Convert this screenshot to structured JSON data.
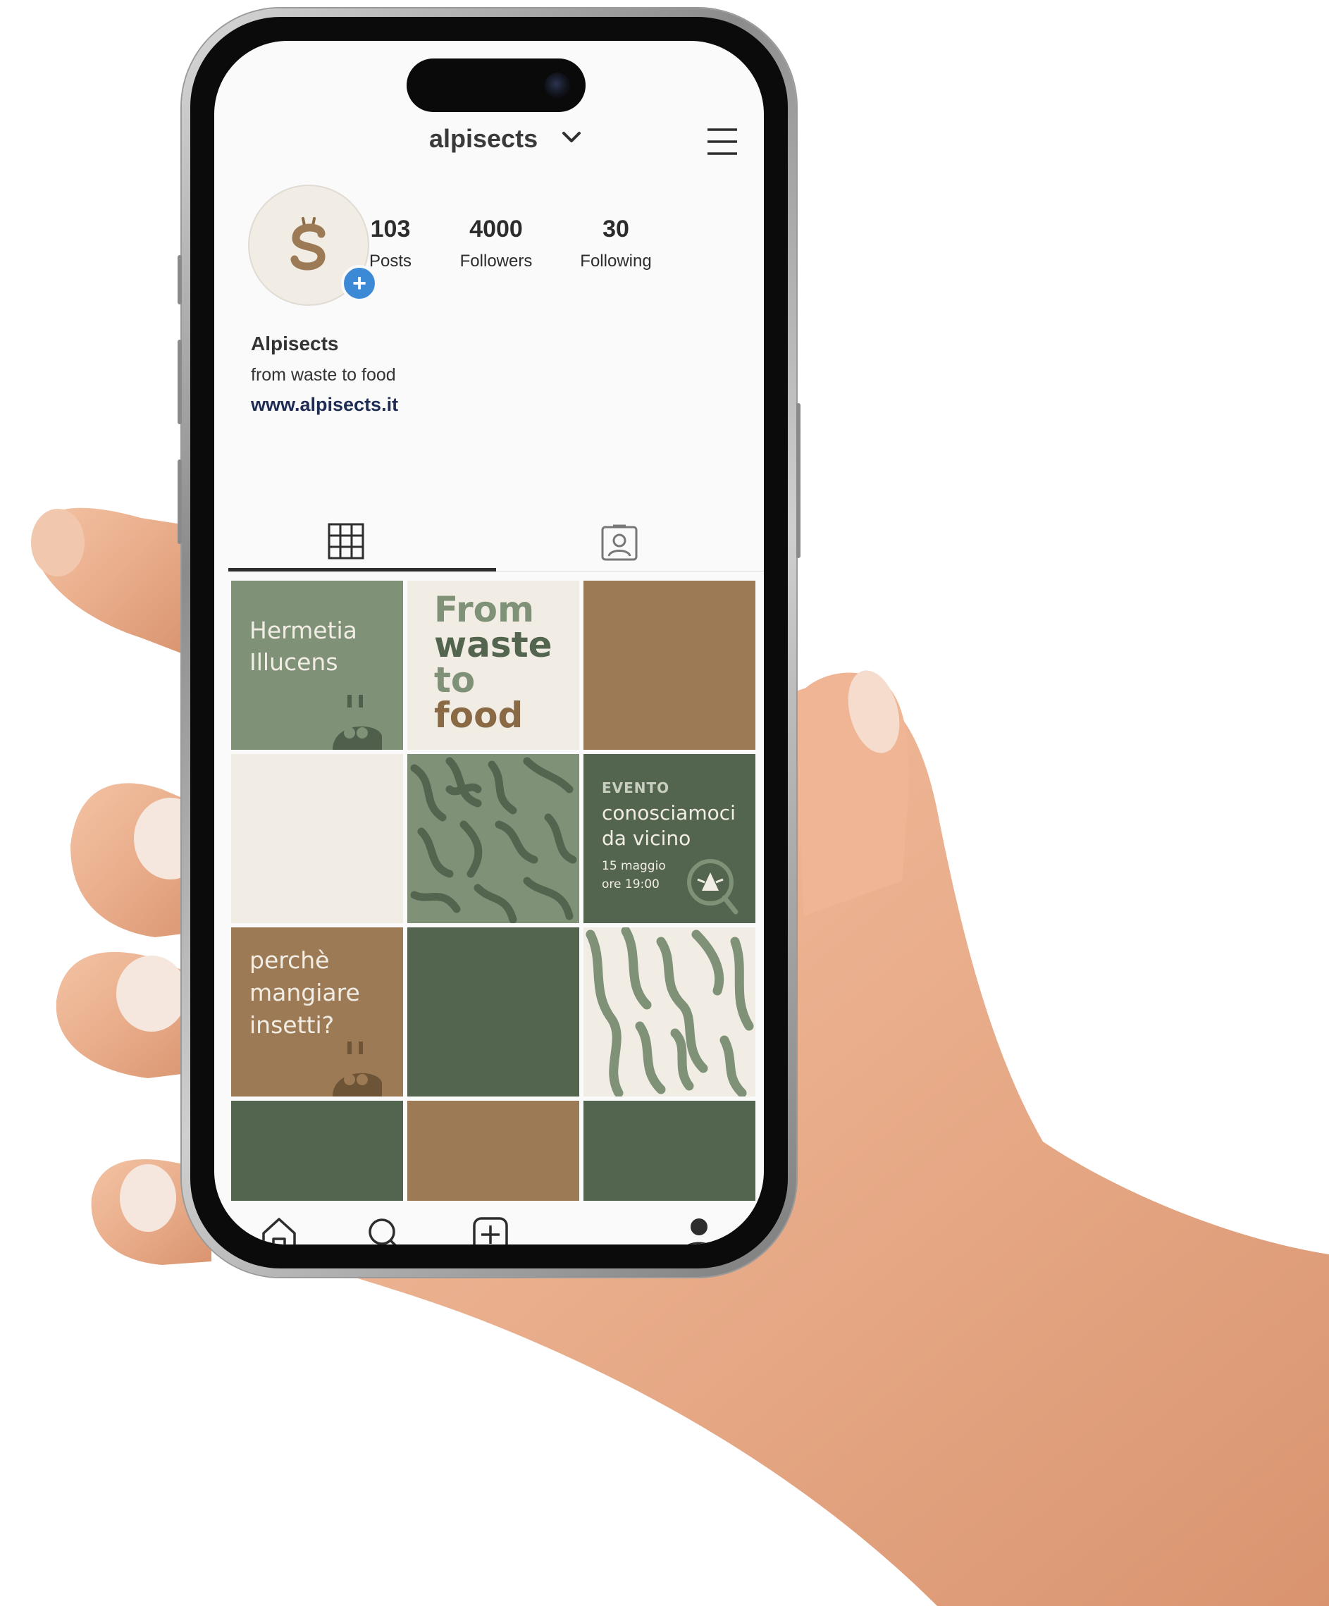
{
  "profile": {
    "username": "alpisects",
    "posts_count": "103",
    "posts_label": "Posts",
    "followers_count": "4000",
    "followers_label": "Followers",
    "following_count": "30",
    "following_label": "Following",
    "display_name": "Alpisects",
    "bio": "from waste to food",
    "website": "www.alpisects.it"
  },
  "tabs": [
    {
      "icon": "grid-icon",
      "active": true
    },
    {
      "icon": "tagged-icon",
      "active": false
    }
  ],
  "posts": {
    "p1": {
      "line1": "Hermetia",
      "line2": "Illucens"
    },
    "p2": {
      "line1": "From",
      "line2": "waste",
      "line3": "to",
      "line4": "food"
    },
    "p6": {
      "tag": "EVENTO",
      "line1": "conosciamoci",
      "line2": "da vicino",
      "date": "15 maggio",
      "time": "ore 19:00"
    },
    "p7": {
      "line1": "perchè",
      "line2": "mangiare",
      "line3": "insetti?"
    }
  },
  "bottom_nav": [
    "home-icon",
    "search-icon",
    "create-icon",
    "profile-icon"
  ],
  "colors": {
    "sage": "#7f9177",
    "dark_green": "#53654f",
    "brown": "#9c7a55",
    "cream": "#f2ede4",
    "accent_blue": "#3c8ad6"
  }
}
